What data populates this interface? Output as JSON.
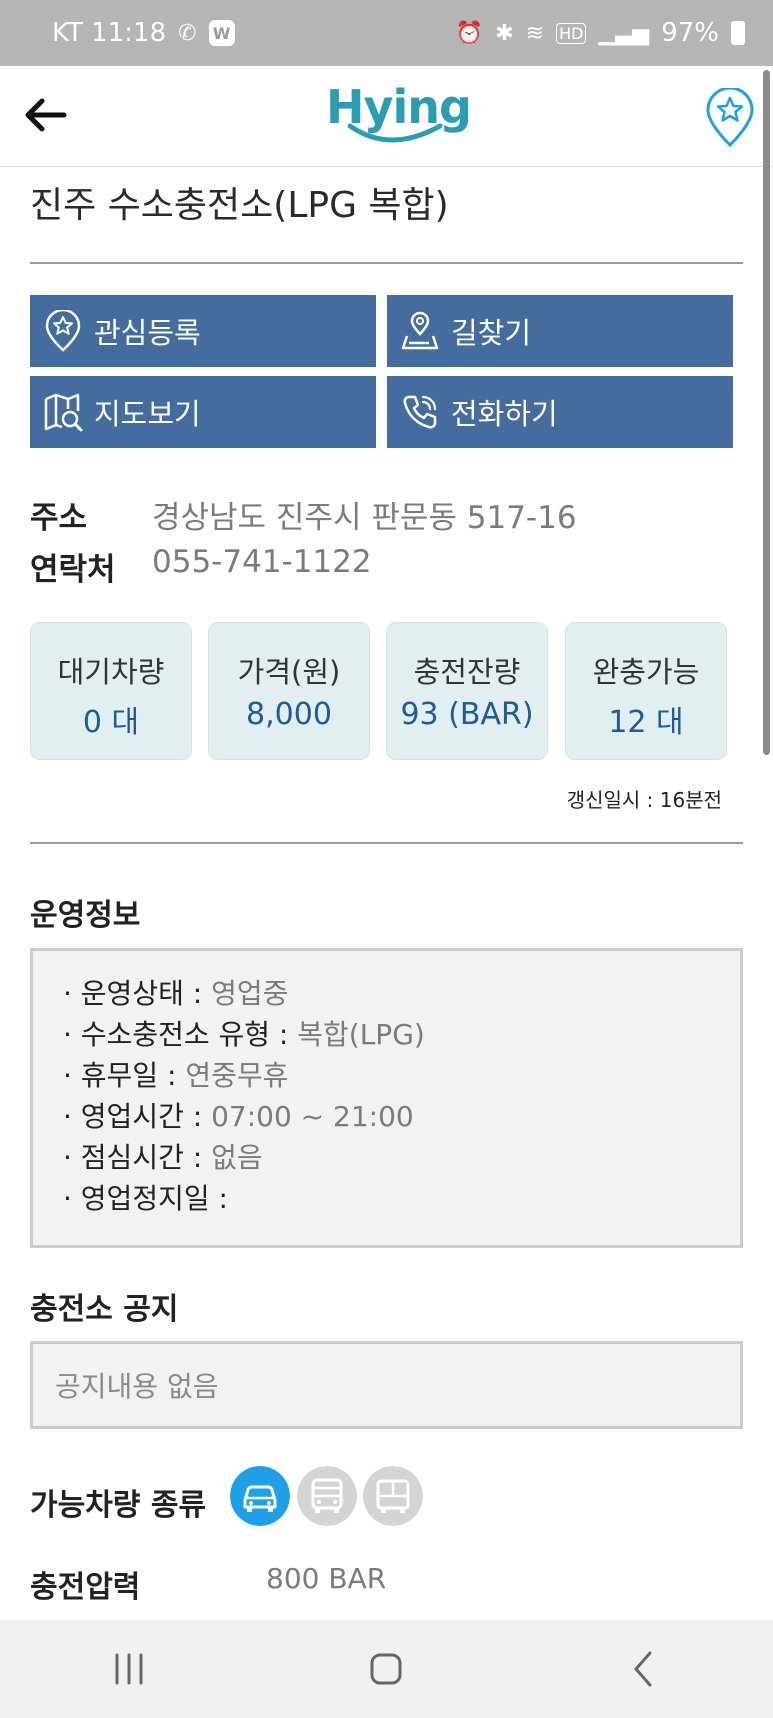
{
  "status_bar": {
    "carrier_time": "KT 11:18",
    "badge": "W",
    "battery": "97%"
  },
  "header": {
    "logo": "Hying"
  },
  "station": {
    "title": "진주 수소충전소(LPG 복합)"
  },
  "actions": {
    "favorite": "관심등록",
    "directions": "길찾기",
    "map": "지도보기",
    "call": "전화하기"
  },
  "info": {
    "address_label": "주소",
    "address_value": "경상남도 진주시 판문동 517-16",
    "contact_label": "연락처",
    "contact_value": "055-741-1122"
  },
  "stats": [
    {
      "label": "대기차량",
      "value": "0 대"
    },
    {
      "label": "가격(원)",
      "value": "8,000"
    },
    {
      "label": "충전잔량",
      "value": "93 (BAR)"
    },
    {
      "label": "완충가능",
      "value": "12 대"
    }
  ],
  "updated": "갱신일시 : 16분전",
  "operation": {
    "title": "운영정보",
    "items": [
      {
        "label": "· 운영상태 : ",
        "value": "영업중"
      },
      {
        "label": "· 수소충전소 유형 : ",
        "value": "복합(LPG)"
      },
      {
        "label": "· 휴무일 : ",
        "value": "연중무휴"
      },
      {
        "label": "· 영업시간 : ",
        "value": "07:00 ~ 21:00"
      },
      {
        "label": "· 점심시간 : ",
        "value": "없음"
      },
      {
        "label": "· 영업정지일 : ",
        "value": ""
      }
    ]
  },
  "notice": {
    "title": "충전소 공지",
    "content": "공지내용 없음"
  },
  "vehicles": {
    "label": "가능차량 종류"
  },
  "pressure": {
    "label": "충전압력",
    "value": "800 BAR"
  },
  "colors": {
    "primary": "#456c9f",
    "accent": "#2a9db0",
    "active_vehicle": "#1ea0e6"
  }
}
